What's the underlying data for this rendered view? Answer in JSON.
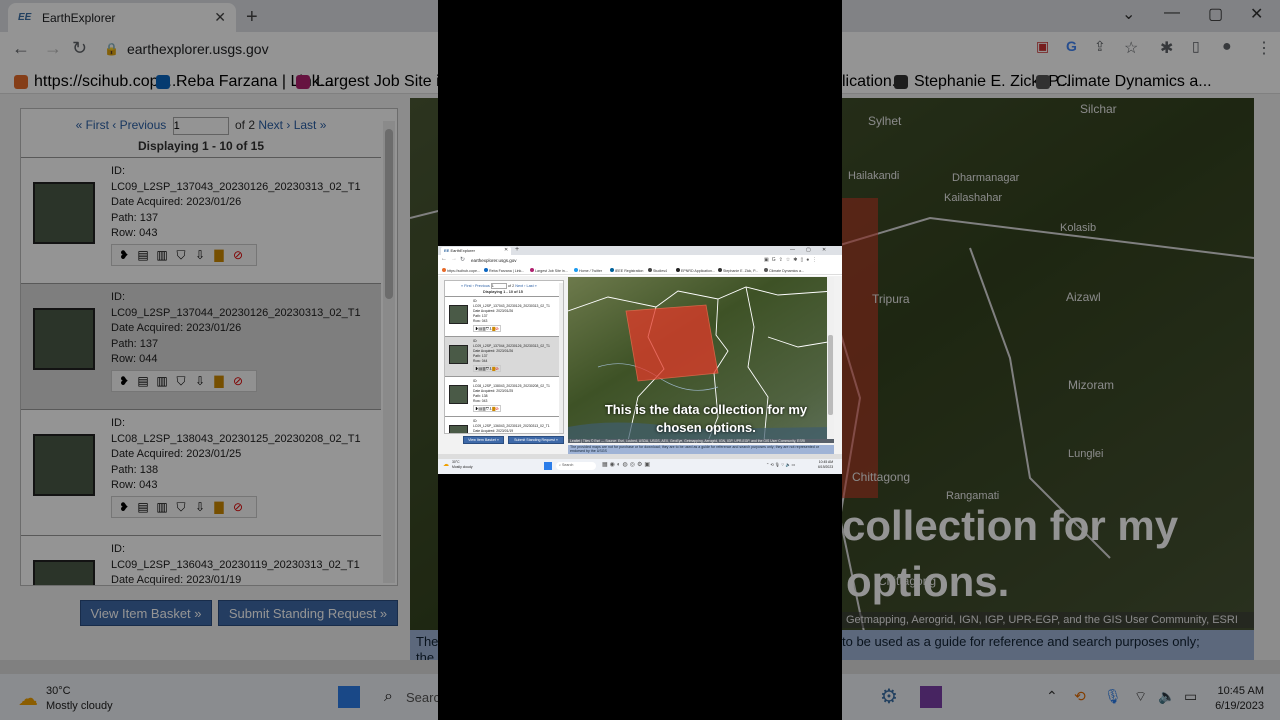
{
  "tab": {
    "favicon": "EE",
    "title": "EarthExplorer"
  },
  "address": {
    "url": "earthexplorer.usgs.gov"
  },
  "bookmarks": [
    {
      "label": "https://scihub.cope...",
      "color": "#e66b2a"
    },
    {
      "label": "Reba Farzana | Link...",
      "color": "#0a66c2"
    },
    {
      "label": "Largest Job Site in...",
      "color": "#b0216f"
    },
    {
      "label": "Home / Twitter",
      "color": "#1d9bf0"
    },
    {
      "label": "IEEE Registration",
      "color": "#00629b"
    },
    {
      "label": "Studies4",
      "color": "#444444"
    },
    {
      "label": "EPNRD Application...",
      "color": "#222222"
    },
    {
      "label": "Stephanie E. Zick, P...",
      "color": "#333333"
    },
    {
      "label": "Climate Dynamics a...",
      "color": "#555555"
    }
  ],
  "bg_bookmarks_right": [
    "lication...",
    "Stephanie E. Zick, P...",
    "Climate Dynamics a..."
  ],
  "pager": {
    "first": "« First",
    "previous": "‹ Previous",
    "page_value": "1",
    "of": "of 2",
    "next": "Next ›",
    "last": "Last »"
  },
  "displaying": "Displaying 1 - 10 of 15",
  "results": [
    {
      "id_label": "ID:",
      "id": "LC09_L2SP_137043_20230126_20230313_02_T1",
      "date_label": "Date Acquired:",
      "date": "2023/01/26",
      "path_label": "Path:",
      "path": "137",
      "row_label": "Row:",
      "row": "043"
    },
    {
      "id_label": "ID:",
      "id": "LC09_L2SP_137044_20230126_20230313_02_T1",
      "date_label": "Date Acquired:",
      "date": "2023/01/26",
      "path_label": "Path:",
      "path": "137",
      "row_label": "Row:",
      "row": "044"
    },
    {
      "id_label": "ID:",
      "id": "LC08_L2SP_138043_20230125_20230208_02_T1",
      "date_label": "Date Acquired:",
      "date": "2023/01/25",
      "path_label": "Path:",
      "path": "138",
      "row_label": "Row:",
      "row": "043"
    },
    {
      "id_label": "ID:",
      "id": "LC09_L2SP_136043_20230119_20230313_02_T1",
      "date_label": "Date Acquired:",
      "date": "2023/01/19",
      "path_label": "",
      "path": "",
      "row_label": "",
      "row": ""
    }
  ],
  "buttons": {
    "basket": "View Item Basket »",
    "standing": "Submit Standing Request »"
  },
  "map_labels_bg": [
    {
      "text": "Silchar"
    },
    {
      "text": "Sylhet"
    },
    {
      "text": "Hailakandi"
    },
    {
      "text": "Dharmanagar"
    },
    {
      "text": "Kailashahar"
    },
    {
      "text": "Kolasib"
    },
    {
      "text": "Tripura"
    },
    {
      "text": "Aizawl"
    },
    {
      "text": "Mizoram"
    },
    {
      "text": "Lunglei"
    },
    {
      "text": "Chittagong"
    },
    {
      "text": "Rangamati"
    },
    {
      "text": "Chittagong"
    }
  ],
  "map_attribution": "Leaflet | Tiles © Esri — Source: Esri, i-cubed, USDA, USGS, AEX, GeoEye, Getmapping, Aerogrid, IGN, IGP, UPR-EGP, and the GIS User Community, ESRI",
  "map_attribution_bg": "Getmapping, Aerogrid, IGN, IGP, UPR-EGP, and the GIS User Community, ESRI",
  "disclaimer": "The provided maps are not for purchase or for download; they are to be used as a guide for reference and search purposes only; they are not represented or endorsed by the USGS",
  "disclaimer_bg_line1": "The",
  "disclaimer_bg_line2": "the",
  "disclaimer_bg_right": "to be used as a guide for reference and search purposes only;",
  "caption": {
    "line1": "This is the data collection for my",
    "line2": "chosen options."
  },
  "caption_bg": {
    "line1": "collection for my",
    "line2": "options."
  },
  "taskbar": {
    "temp": "30°C",
    "weather": "Mostly cloudy",
    "search": "Search",
    "time": "10:45 AM",
    "date": "6/19/2023"
  },
  "colors": {
    "accent_button": "#3e69a8",
    "footprint": "#e23a2a",
    "link": "#2a5fa5"
  }
}
